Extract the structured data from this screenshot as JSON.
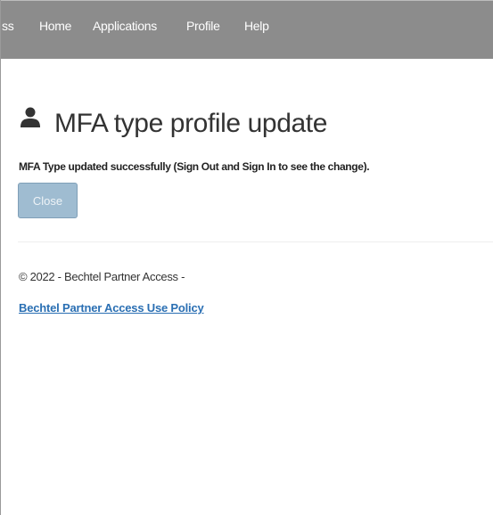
{
  "navbar": {
    "items": [
      {
        "label": "ss"
      },
      {
        "label": "Home"
      },
      {
        "label": "Applications"
      },
      {
        "label": "Profile"
      },
      {
        "label": "Help"
      }
    ],
    "background_color": "#8c8c8c",
    "text_color": "#ffffff"
  },
  "page": {
    "title": "MFA type profile update",
    "title_icon": "user-icon",
    "message": "MFA Type updated successfully (Sign Out and Sign In to see the change).",
    "close_button_label": "Close",
    "close_button_color": "#9fbcd1"
  },
  "footer": {
    "copyright": "© 2022 - Bechtel Partner Access -",
    "policy_link": "Bechtel Partner Access Use Policy",
    "link_color": "#2a6fb3"
  }
}
